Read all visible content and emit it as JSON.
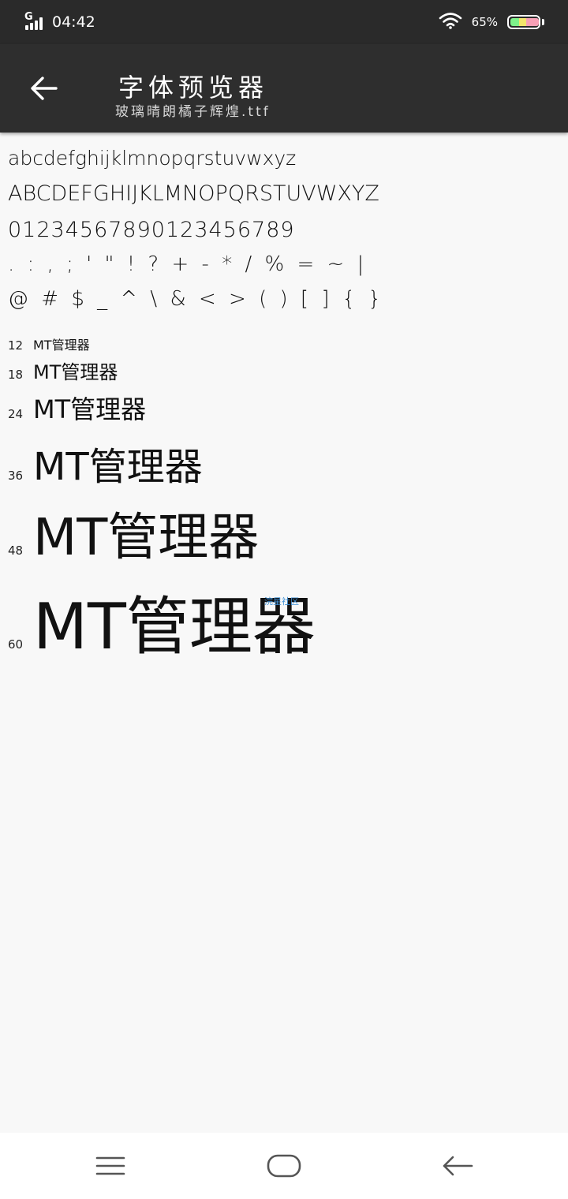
{
  "status_bar": {
    "network": "G",
    "time": "04:42",
    "battery": "65%"
  },
  "app_bar": {
    "title": "字体预览器",
    "subtitle": "玻璃晴朗橘子辉煌.ttf"
  },
  "preview": {
    "lowercase": "abcdefghijklmnopqrstuvwxyz",
    "uppercase": "ABCDEFGHIJKLMNOPQRSTUVWXYZ",
    "digits": "01234567890123456789",
    "punctuation": ". : , ; ' \" ! ? + - * / % = ~ |",
    "symbols": "@ # $ _ ^ \\ & < > ( ) [ ] { }",
    "sizes": [
      {
        "size": "12",
        "text": "MT管理器"
      },
      {
        "size": "18",
        "text": "MT管理器"
      },
      {
        "size": "24",
        "text": "MT管理器"
      },
      {
        "size": "36",
        "text": "MT管理器"
      },
      {
        "size": "48",
        "text": "MT管理器"
      },
      {
        "size": "60",
        "text": "MT管理器"
      }
    ],
    "watermark": "浣星社区"
  },
  "icons": {
    "back": "back-arrow-icon",
    "wifi": "wifi-icon",
    "menu": "menu-icon",
    "home": "home-icon",
    "nav_back": "nav-back-icon"
  }
}
